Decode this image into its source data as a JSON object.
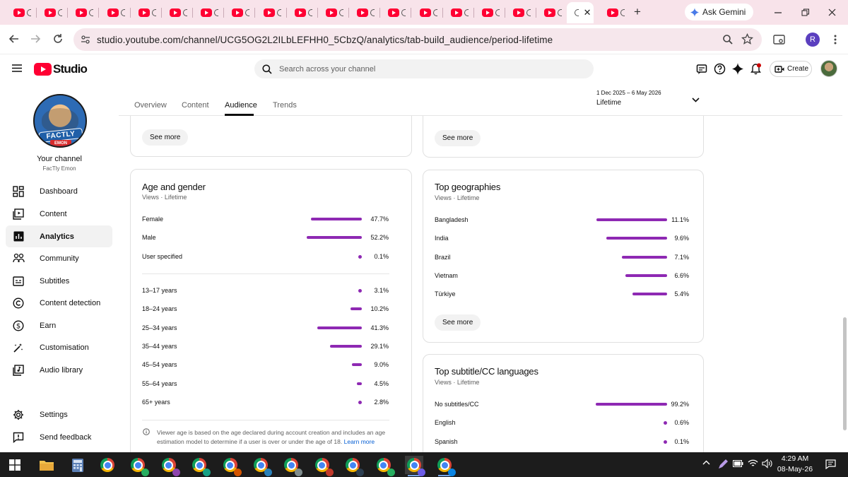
{
  "browser": {
    "tab_count": 20,
    "url": "studio.youtube.com/channel/UCG5OG2L2ILbLEFHH0_5CbzQ/analytics/tab-build_audience/period-lifetime",
    "ask_gemini_label": "Ask Gemini",
    "profile_initial": "R"
  },
  "header": {
    "logo_text": "Studio",
    "search_placeholder": "Search across your channel",
    "create_label": "Create"
  },
  "channel": {
    "avatar_text_top": "FACTLY",
    "avatar_text_bottom": "EMON",
    "title": "Your channel",
    "name": "FacTly Emon"
  },
  "sidebar": {
    "items": [
      {
        "label": "Dashboard",
        "icon": "dashboard-icon"
      },
      {
        "label": "Content",
        "icon": "content-icon"
      },
      {
        "label": "Analytics",
        "icon": "analytics-icon",
        "active": true
      },
      {
        "label": "Community",
        "icon": "community-icon"
      },
      {
        "label": "Subtitles",
        "icon": "subtitles-icon"
      },
      {
        "label": "Content detection",
        "icon": "content-detection-icon"
      },
      {
        "label": "Earn",
        "icon": "earn-icon"
      },
      {
        "label": "Customisation",
        "icon": "customisation-icon"
      },
      {
        "label": "Audio library",
        "icon": "audio-library-icon"
      }
    ],
    "bottom_items": [
      {
        "label": "Settings",
        "icon": "settings-icon"
      },
      {
        "label": "Send feedback",
        "icon": "feedback-icon"
      }
    ]
  },
  "analytics": {
    "tabs": [
      "Overview",
      "Content",
      "Audience",
      "Trends"
    ],
    "active_tab": "Audience",
    "period_range": "1 Dec 2025 – 6 May 2026",
    "period_label": "Lifetime"
  },
  "cards": {
    "top_left_see_more": "See more",
    "top_right_see_more": "See more",
    "age_gender": {
      "title": "Age and gender",
      "subtitle": "Views · Lifetime",
      "gender": [
        {
          "label": "Female",
          "value": "47.7%",
          "fraction": 0.477
        },
        {
          "label": "Male",
          "value": "52.2%",
          "fraction": 0.522
        },
        {
          "label": "User specified",
          "value": "0.1%",
          "fraction": 0.001
        }
      ],
      "age": [
        {
          "label": "13–17 years",
          "value": "3.1%",
          "fraction": 0.031
        },
        {
          "label": "18–24 years",
          "value": "10.2%",
          "fraction": 0.102
        },
        {
          "label": "25–34 years",
          "value": "41.3%",
          "fraction": 0.413
        },
        {
          "label": "35–44 years",
          "value": "29.1%",
          "fraction": 0.291
        },
        {
          "label": "45–54 years",
          "value": "9.0%",
          "fraction": 0.09
        },
        {
          "label": "55–64 years",
          "value": "4.5%",
          "fraction": 0.045
        },
        {
          "label": "65+ years",
          "value": "2.8%",
          "fraction": 0.028
        }
      ],
      "note": "Viewer age is based on the age declared during account creation and includes an age estimation model to determine if a user is over or under the age of 18.",
      "learn_more": "Learn more"
    },
    "geographies": {
      "title": "Top geographies",
      "subtitle": "Views · Lifetime",
      "rows": [
        {
          "label": "Bangladesh",
          "value": "11.1%",
          "fraction": 0.111
        },
        {
          "label": "India",
          "value": "9.6%",
          "fraction": 0.096
        },
        {
          "label": "Brazil",
          "value": "7.1%",
          "fraction": 0.071
        },
        {
          "label": "Vietnam",
          "value": "6.6%",
          "fraction": 0.066
        },
        {
          "label": "Türkiye",
          "value": "5.4%",
          "fraction": 0.054
        }
      ],
      "see_more": "See more"
    },
    "subtitles": {
      "title": "Top subtitle/CC languages",
      "subtitle": "Views · Lifetime",
      "rows": [
        {
          "label": "No subtitles/CC",
          "value": "99.2%",
          "fraction": 0.992
        },
        {
          "label": "English",
          "value": "0.6%",
          "fraction": 0.006
        },
        {
          "label": "Spanish",
          "value": "0.1%",
          "fraction": 0.001
        }
      ]
    }
  },
  "taskbar": {
    "time": "4:29 AM",
    "date": "08-May-26",
    "apps": [
      "start-icon",
      "file-explorer-icon",
      "calculator-icon",
      "chrome-icon",
      "chrome-profile-icon",
      "chrome-profile-icon",
      "chrome-profile-icon",
      "chrome-profile-icon",
      "chrome-profile-icon",
      "chrome-profile-icon",
      "chrome-profile-icon",
      "chrome-profile-icon",
      "chrome-profile-icon",
      "chrome-profile-icon",
      "chrome-profile-icon"
    ]
  },
  "colors": {
    "bar": "#8e29b3",
    "brand_red": "#ff0033",
    "tabstrip": "#f8e3ea"
  }
}
